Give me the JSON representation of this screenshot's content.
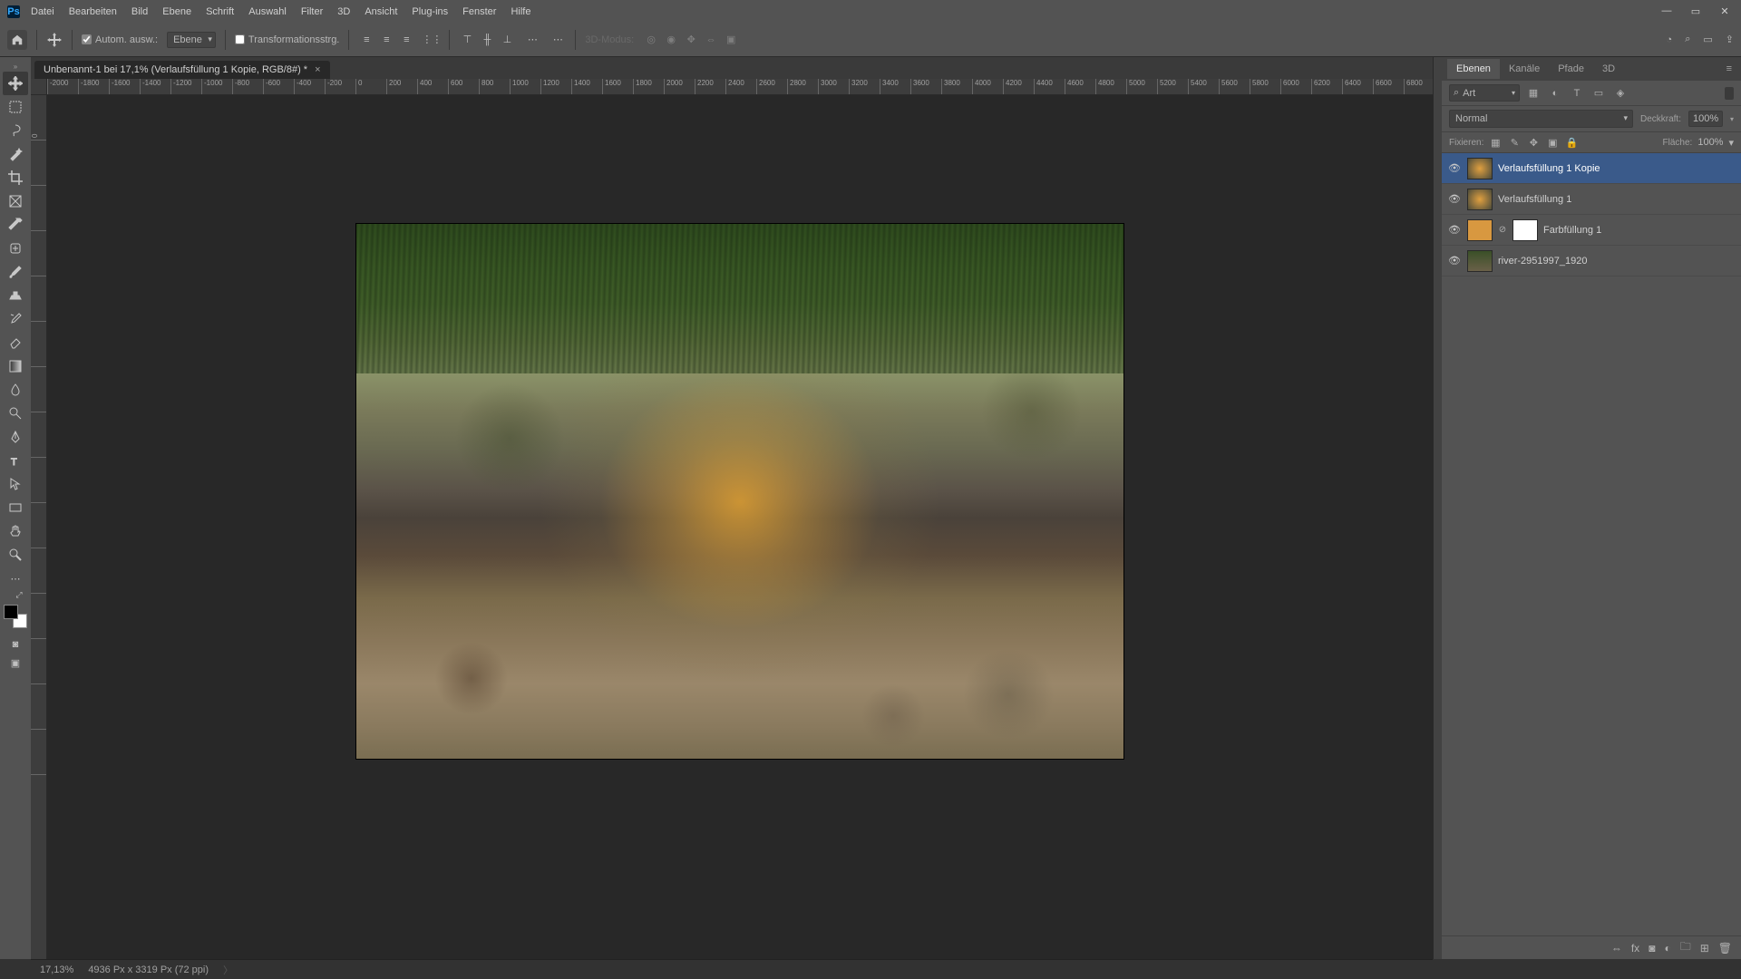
{
  "app": {
    "logo_text": "Ps"
  },
  "menu": [
    "Datei",
    "Bearbeiten",
    "Bild",
    "Ebene",
    "Schrift",
    "Auswahl",
    "Filter",
    "3D",
    "Ansicht",
    "Plug-ins",
    "Fenster",
    "Hilfe"
  ],
  "win_controls": {
    "min": "—",
    "max": "▭",
    "close": "✕"
  },
  "options": {
    "auto_select_label": "Autom. ausw.:",
    "target_select": "Ebene",
    "transform_label": "Transformationsstrg.",
    "mode3d_label": "3D-Modus:"
  },
  "doc_tab": {
    "title": "Unbenannt-1 bei 17,1% (Verlaufsfüllung 1 Kopie, RGB/8#) *",
    "close": "×"
  },
  "ruler_h": [
    "-2000",
    "-1800",
    "-1600",
    "-1400",
    "-1200",
    "-1000",
    "-800",
    "-600",
    "-400",
    "-200",
    "0",
    "200",
    "400",
    "600",
    "800",
    "1000",
    "1200",
    "1400",
    "1600",
    "1800",
    "2000",
    "2200",
    "2400",
    "2600",
    "2800",
    "3000",
    "3200",
    "3400",
    "3600",
    "3800",
    "4000",
    "4200",
    "4400",
    "4600",
    "4800",
    "5000",
    "5200",
    "5400",
    "5600",
    "5800",
    "6000",
    "6200",
    "6400",
    "6600",
    "6800"
  ],
  "ruler_v": [
    "0",
    "",
    "",
    "",
    "",
    "",
    "",
    "",
    "",
    "",
    "",
    "",
    "",
    "",
    ""
  ],
  "panels": {
    "tabs": [
      "Ebenen",
      "Kanäle",
      "Pfade",
      "3D"
    ],
    "filter_mode": "Art",
    "blend_mode": "Normal",
    "opacity_label": "Deckkraft:",
    "opacity_value": "100%",
    "lock_label": "Fixieren:",
    "fill_label": "Fläche:",
    "fill_value": "100%",
    "layers": [
      {
        "name": "Verlaufsfüllung 1 Kopie",
        "type": "gradient",
        "selected": true
      },
      {
        "name": "Verlaufsfüllung 1",
        "type": "gradient",
        "selected": false
      },
      {
        "name": "Farbfüllung 1",
        "type": "colorfill",
        "selected": false
      },
      {
        "name": "river-2951997_1920",
        "type": "photo",
        "selected": false
      }
    ]
  },
  "status": {
    "zoom": "17,13%",
    "doc_info": "4936 Px x 3319 Px (72 ppi)",
    "arrow": "〉"
  }
}
